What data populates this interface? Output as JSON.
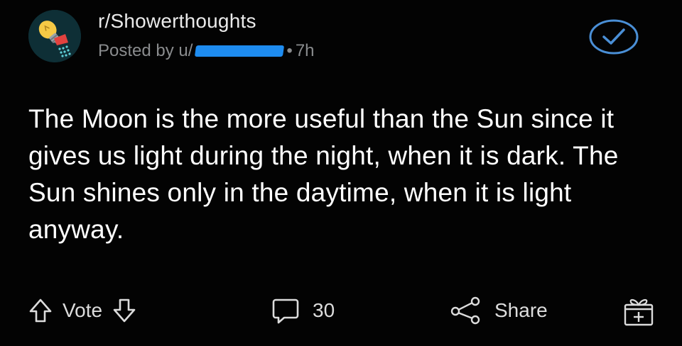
{
  "header": {
    "subreddit": "r/Showerthoughts",
    "posted_by_prefix": "Posted by u/",
    "separator": "•",
    "age": "7h"
  },
  "post": {
    "title": "The Moon is the more useful than the Sun since it gives us light during the night, when it is dark. The Sun shines only in the daytime, when it is light anyway."
  },
  "actions": {
    "vote_label": "Vote",
    "comments_count": "30",
    "share_label": "Share"
  },
  "icons": {
    "avatar": "shower-lightbulb-icon",
    "joined": "checkmark-circle-icon",
    "upvote": "arrow-up-icon",
    "downvote": "arrow-down-icon",
    "comments": "comment-bubble-icon",
    "share": "share-icon",
    "award": "gift-icon"
  },
  "colors": {
    "background": "#030303",
    "text": "#ffffff",
    "meta": "#8a8c8e",
    "joined_accent": "#4a8fd6",
    "redaction": "#1e8cf0",
    "avatar_bg": "#0e2f36"
  }
}
